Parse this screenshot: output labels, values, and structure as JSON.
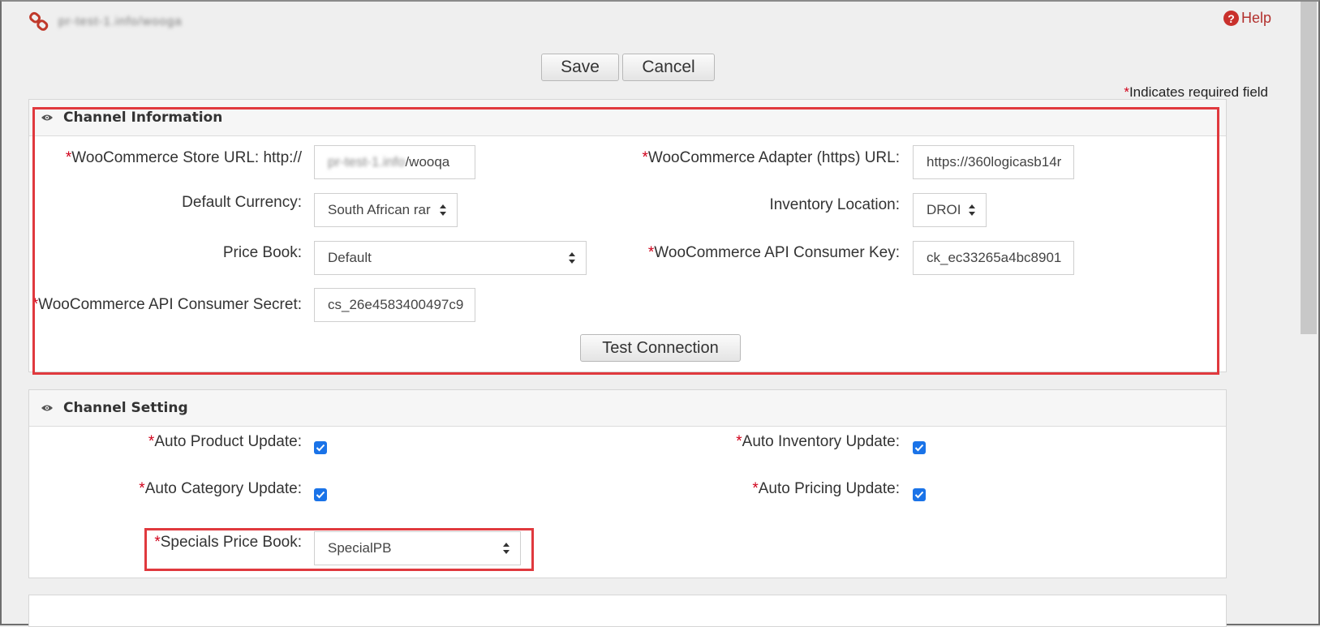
{
  "header": {
    "record_name": "pr-test-1.info/wooga",
    "help_label": "Help",
    "help_icon": "question-circle-icon",
    "link_icon": "link-icon"
  },
  "toolbar": {
    "save_label": "Save",
    "cancel_label": "Cancel"
  },
  "required_note": {
    "star": "*",
    "text": "Indicates required field"
  },
  "channel_information": {
    "title": "Channel Information",
    "store_url": {
      "label": "WooCommerce Store URL: http://",
      "value_hidden": "pr-test-1.info",
      "value_suffix": "/wooqa"
    },
    "adapter_url": {
      "label": "WooCommerce Adapter (https) URL:",
      "value": "https://360logicasb14r"
    },
    "default_currency": {
      "label": "Default Currency:",
      "value": "South African rar"
    },
    "inventory_location": {
      "label": "Inventory Location:",
      "value": "DROI"
    },
    "price_book": {
      "label": "Price Book:",
      "value": "Default"
    },
    "consumer_key": {
      "label": "WooCommerce API Consumer Key:",
      "value": "ck_ec33265a4bc8901"
    },
    "consumer_secret": {
      "label": "WooCommerce API Consumer Secret:",
      "value": "cs_26e4583400497c9"
    },
    "test_connection_label": "Test Connection"
  },
  "channel_setting": {
    "title": "Channel Setting",
    "auto_product_update": {
      "label": "Auto Product Update:",
      "checked": true
    },
    "auto_inventory_update": {
      "label": "Auto Inventory Update:",
      "checked": true
    },
    "auto_category_update": {
      "label": "Auto Category Update:",
      "checked": true
    },
    "auto_pricing_update": {
      "label": "Auto Pricing Update:",
      "checked": true
    },
    "specials_price_book": {
      "label": "Specials Price Book:",
      "value": "SpecialPB"
    }
  },
  "colors": {
    "required": "#d0021b",
    "highlight": "#e0393e",
    "checkbox": "#1a73e8"
  }
}
